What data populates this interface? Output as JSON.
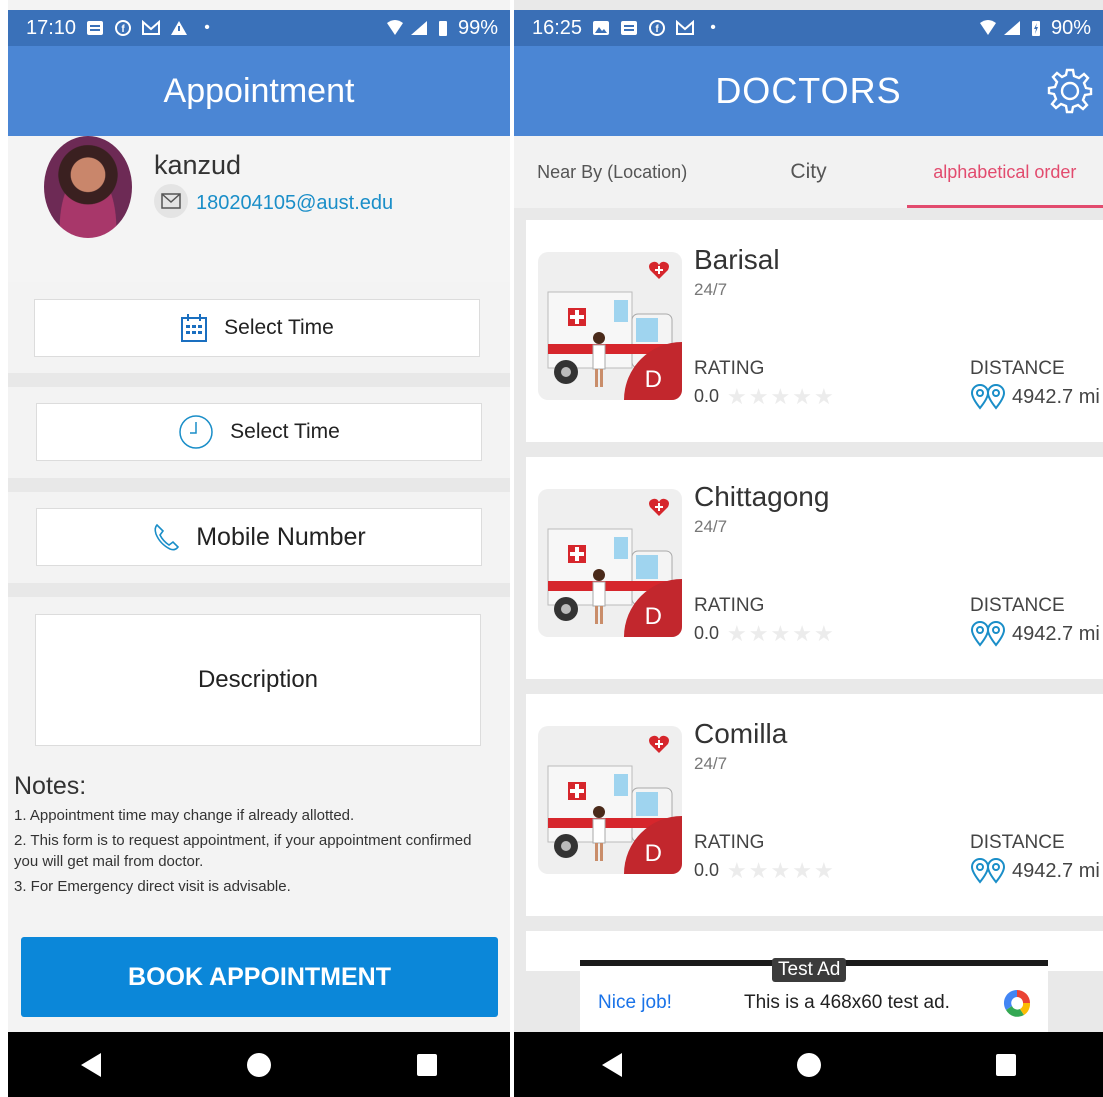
{
  "left": {
    "status": {
      "time": "17:10",
      "battery": "99%"
    },
    "title": "Appointment",
    "profile": {
      "name": "kanzud",
      "email": "180204105@aust.edu"
    },
    "fields": {
      "date": "Select Time",
      "time": "Select Time",
      "mobile": "Mobile Number",
      "description": "Description"
    },
    "notes": {
      "title": "Notes:",
      "items": [
        "1. Appointment time may change if already allotted.",
        "2. This form is to request appointment, if your appointment confirmed you will get mail from doctor.",
        "3. For Emergency direct visit is advisable."
      ]
    },
    "book_button": "BOOK APPOINTMENT"
  },
  "right": {
    "status": {
      "time": "16:25",
      "battery": "90%"
    },
    "title": "DOCTORS",
    "tabs": [
      "Near By (Location)",
      "City",
      "alphabetical order"
    ],
    "active_tab": 2,
    "cards": [
      {
        "name": "Barisal",
        "hours": "24/7",
        "rating_label": "RATING",
        "rating": "0.0",
        "distance_label": "DISTANCE",
        "distance": "4942.7 mi",
        "badge": "D"
      },
      {
        "name": "Chittagong",
        "hours": "24/7",
        "rating_label": "RATING",
        "rating": "0.0",
        "distance_label": "DISTANCE",
        "distance": "4942.7 mi",
        "badge": "D"
      },
      {
        "name": "Comilla",
        "hours": "24/7",
        "rating_label": "RATING",
        "rating": "0.0",
        "distance_label": "DISTANCE",
        "distance": "4942.7 mi",
        "badge": "D"
      }
    ],
    "ad": {
      "tag": "Test Ad",
      "nice": "Nice job!",
      "text": "This is a 468x60 test ad."
    }
  },
  "colors": {
    "appbar": "#4b86d4",
    "statusbar": "#3a71b9",
    "accent_tab": "#e24b6e",
    "book_button": "#0b87d9",
    "badge": "#c2272d",
    "link": "#1a8ec8"
  }
}
